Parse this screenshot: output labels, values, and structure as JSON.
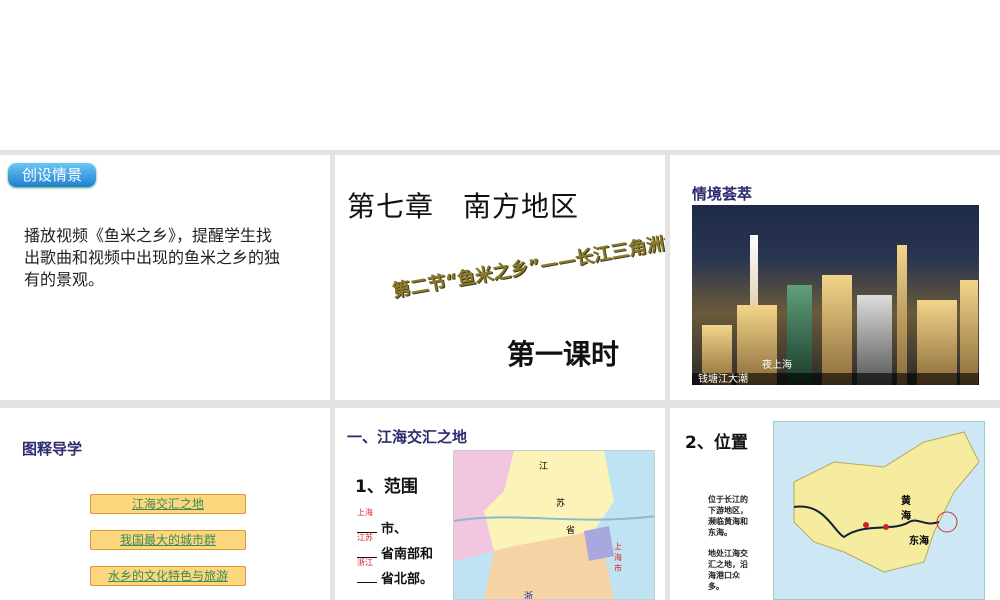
{
  "slides": {
    "s1": {
      "badge": "创设情景",
      "body": "播放视频《鱼米之乡》，提醒学生找出歌曲和视频中出现的鱼米之乡的独有的景观。"
    },
    "s2": {
      "chapter": "第七章　南方地区",
      "section": "第二节“鱼米之乡”——长江三角洲地区",
      "lesson": "第一课时"
    },
    "s3": {
      "title": "情境荟萃",
      "caption_main": "夜上海",
      "caption_bottom": "钱塘江大潮"
    },
    "s4": {
      "title": "图释导学",
      "links": [
        "江海交汇之地",
        "我国最大的城市群",
        "水乡的文化特色与旅游"
      ]
    },
    "s5": {
      "title": "一、江海交汇之地",
      "subtitle": "1、范围",
      "lines": [
        {
          "answer": "上海",
          "text": "市、"
        },
        {
          "answer": "江苏",
          "text": "省南部和"
        },
        {
          "answer": "浙江",
          "text": "省北部。"
        }
      ],
      "map_labels": [
        "江",
        "苏",
        "省",
        "上海市",
        "浙"
      ]
    },
    "s6": {
      "title": "2、位置",
      "text1": "位于长江的下游地区，濒临黄海和东海。",
      "text2": "地处江海交汇之地，沿海港口众多。",
      "map_labels": [
        "黄海",
        "东海"
      ]
    }
  },
  "colors": {
    "heading": "#2b2b6e",
    "answer": "#dd2222",
    "link": "#3a8a5a"
  }
}
